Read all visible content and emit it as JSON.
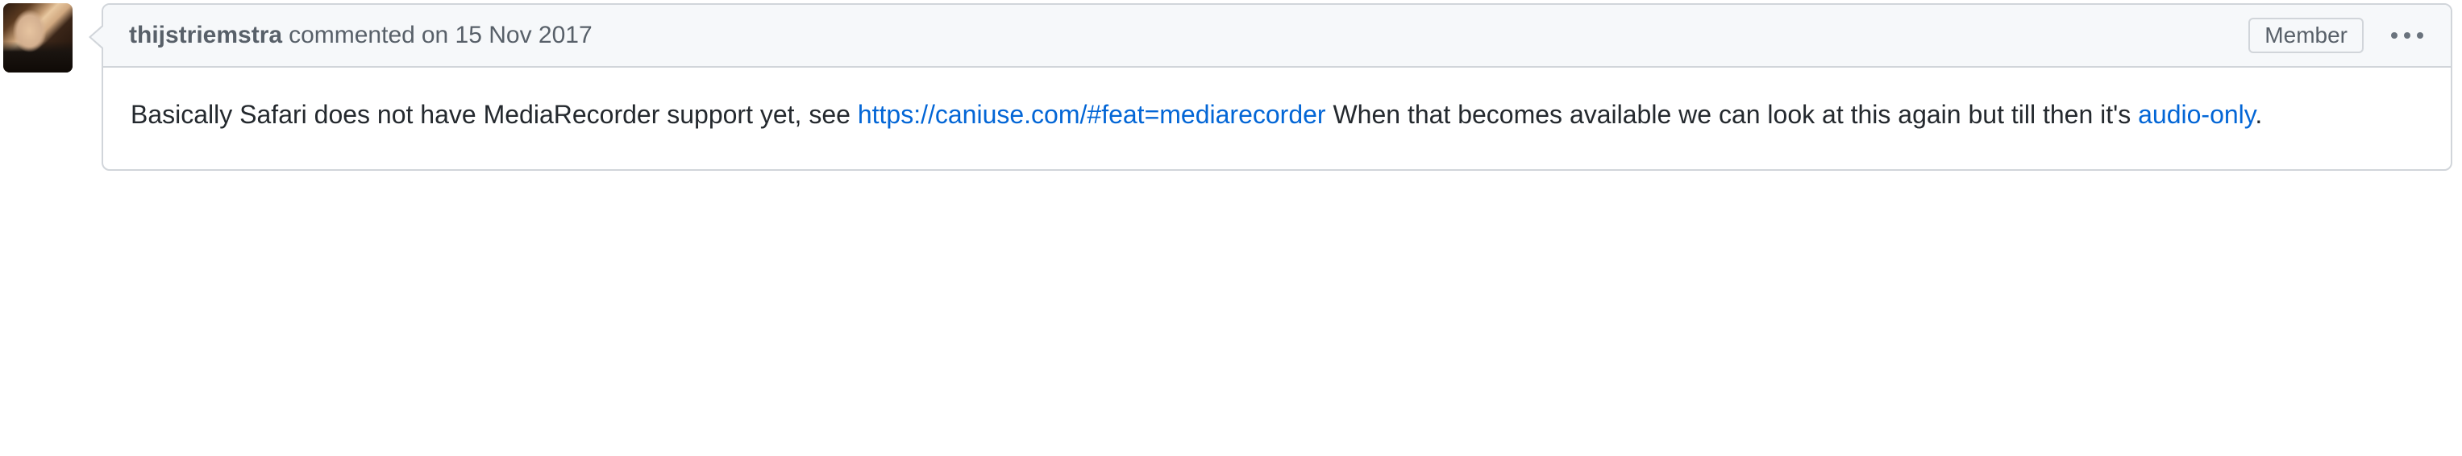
{
  "comment": {
    "author": "thijstriemstra",
    "action": "commented",
    "on_word": "on",
    "date": "15 Nov 2017",
    "badge": "Member",
    "body_part1": "Basically Safari does not have MediaRecorder support yet, see ",
    "body_link1": "https://caniuse.com/#feat=mediarecorder",
    "body_part2": " When that becomes available we can look at this again but till then it's ",
    "body_link2": "audio-only",
    "body_part3": "."
  }
}
